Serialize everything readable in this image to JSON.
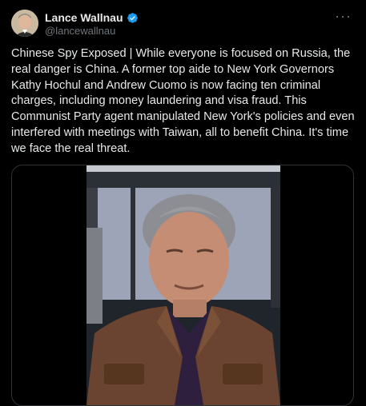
{
  "author": {
    "display_name": "Lance Wallnau",
    "handle": "@lancewallnau",
    "verified": true,
    "verified_color": "#1d9bf0"
  },
  "more_menu": {
    "icon": "more-horizontal-icon",
    "label": "···"
  },
  "tweet": {
    "text": "Chinese Spy Exposed | While everyone is focused on Russia, the real danger is China. A former top aide to New York Governors Kathy Hochul and Andrew Cuomo is now facing ten criminal charges, including money laundering and visa fraud. This Communist Party agent manipulated New York's policies and even interfered with meetings with Taiwan, all to benefit China. It's time we face the real threat."
  },
  "media": {
    "type": "video"
  },
  "colors": {
    "background": "#000000",
    "text": "#e7e9ea",
    "muted": "#71767b",
    "border": "#2f3336"
  }
}
